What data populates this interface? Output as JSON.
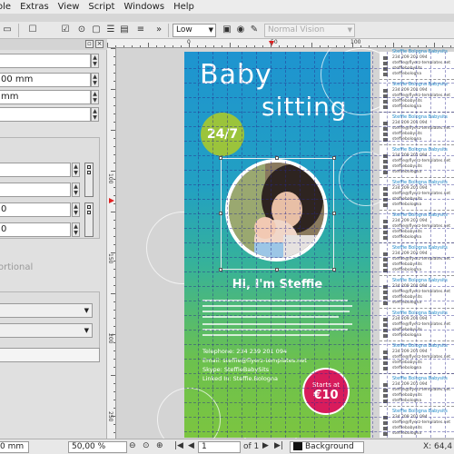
{
  "menu": [
    "ole",
    "Extras",
    "View",
    "Script",
    "Windows",
    "Help"
  ],
  "toolbar": {
    "quality": "Low",
    "vision": "Normal Vision"
  },
  "left_panel": {
    "fields": [
      "",
      "00 mm",
      "mm",
      "",
      "",
      "",
      "0",
      "0"
    ],
    "ghost_label": "ortional"
  },
  "rulers": {
    "h_labels": [
      "0",
      "50",
      "100"
    ],
    "v_labels": [
      "100",
      "150",
      "200",
      "250"
    ]
  },
  "flyer": {
    "title_line1": "Baby",
    "title_line2": "sitting",
    "badge": "24/7",
    "greeting": "Hi, I'm Steffie",
    "contact": [
      "Telephone: 234 239 201 094",
      "Email: steffie@flyerz-templates.net",
      "Skype: SteffieBabySits",
      "Linked In: Steffie.Bologna"
    ],
    "price_label": "Starts at",
    "price": "€10"
  },
  "cards": {
    "title": "Steffie Bologna Babysits",
    "line1": "234 209 201 094",
    "line2": "steffie@flyerz-templates.net",
    "line3": "steffiebabysits",
    "line4": "steffiebologna"
  },
  "status": {
    "left_value": "0 mm",
    "zoom": "50,00 %",
    "page_current": "1",
    "page_of": "of 1",
    "layer": "Background",
    "coord": "X: 64,4"
  },
  "colors": {
    "accent": "#d81c5c",
    "badge": "#9bc43b",
    "gradient_top": "#1e94d0",
    "gradient_bottom": "#7cc540"
  }
}
